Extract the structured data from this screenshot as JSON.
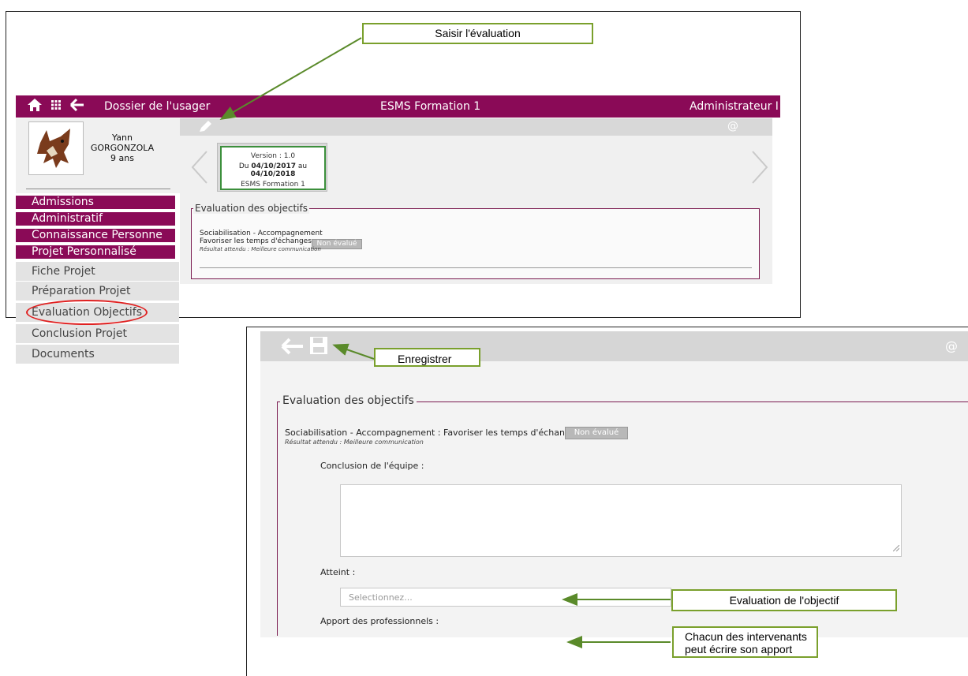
{
  "top": {
    "header": {
      "section": "Dossier de l'usager",
      "center": "ESMS Formation 1",
      "right": "Administrateur I"
    },
    "person": {
      "first": "Yann",
      "last": "GORGONZOLA",
      "age": "9 ans"
    },
    "version": {
      "line1": "Version : 1.0",
      "line2_prefix": "Du ",
      "from": "04/10/2017",
      "mid": " au ",
      "to": "04/10/2018",
      "line3": "ESMS Formation 1"
    },
    "fieldset_legend": "Evaluation des objectifs",
    "objective": {
      "category": "Sociabilisation - Accompagnement",
      "title": "Favoriser les temps d'échanges",
      "status": "Non évalué",
      "result": "Résultat attendu : Meilleure communication"
    },
    "menu": {
      "sections": [
        "Admissions",
        "Administratif",
        "Connaissance Personne",
        "Projet Personnalisé"
      ],
      "items": [
        "Fiche Projet",
        "Préparation Projet",
        "Evaluation Objectifs",
        "Conclusion Projet",
        "Documents"
      ]
    },
    "at_icon": "@"
  },
  "bottom": {
    "fieldset_legend": "Evaluation des objectifs",
    "objective_title": "Sociabilisation - Accompagnement : Favoriser les temps d'échanges",
    "status": "Non évalué",
    "result": "Résultat attendu : Meilleure communication",
    "conclusion_label": "Conclusion de l'équipe :",
    "atteint_label": "Atteint :",
    "select_placeholder": "Selectionnez...",
    "apport_label": "Apport des professionnels :",
    "at_icon": "@"
  },
  "callouts": {
    "saisir": "Saisir l'évaluation",
    "enregistrer": "Enregistrer",
    "evaluation": "Evaluation de l'objectif",
    "chacun_line1": "Chacun des intervenants",
    "chacun_line2": "peut écrire son apport"
  },
  "colors": {
    "magenta": "#8a0a57",
    "callout_border": "#7aa02c",
    "highlight_ring": "#e02020"
  }
}
